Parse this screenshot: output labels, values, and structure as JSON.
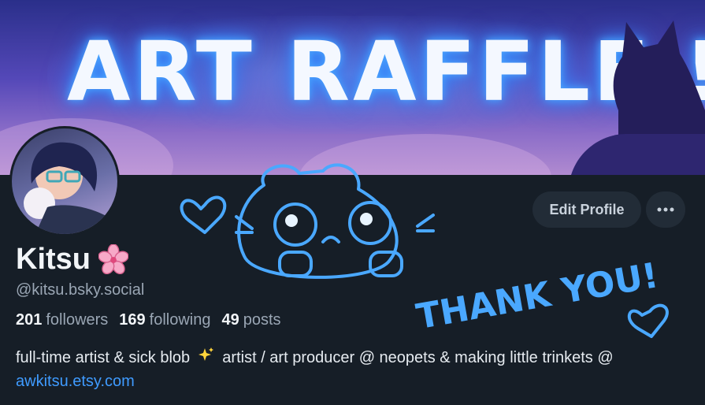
{
  "banner": {
    "title": "ART RAFFLE !",
    "overlay_text": "THANK YOU!"
  },
  "profile": {
    "display_name": "Kitsu",
    "name_emoji": "cherry-blossom-icon",
    "handle": "@kitsu.bsky.social",
    "stats": [
      {
        "count": "201",
        "label": "followers"
      },
      {
        "count": "169",
        "label": "following"
      },
      {
        "count": "49",
        "label": "posts"
      }
    ],
    "bio": {
      "part1": "full-time artist & sick blob",
      "emoji": "sparkles-icon",
      "part2": "artist / art producer @ neopets & making little trinkets @",
      "link": "awkitsu.etsy.com"
    }
  },
  "actions": {
    "edit_label": "Edit Profile",
    "more_icon": "ellipsis-icon"
  },
  "colors": {
    "background": "#161e27",
    "button_bg": "#222c37",
    "link": "#3f9bff",
    "doodle": "#4aa8ff"
  }
}
